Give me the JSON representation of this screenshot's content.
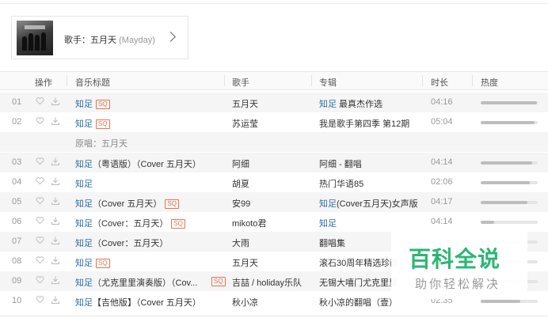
{
  "artist": {
    "prefix": "歌手：",
    "name": "五月天",
    "english": "(Mayday)"
  },
  "columns": {
    "action": "操作",
    "title": "音乐标题",
    "singer": "歌手",
    "album": "专辑",
    "duration": "时长",
    "heat": "热度"
  },
  "quality_badge": "SQ",
  "rows": [
    {
      "idx": "01",
      "title": "知足",
      "title_tail": "",
      "sq": true,
      "sq_right": false,
      "singer": "五月天",
      "album_link": "知足",
      "album_text": " 最真杰作选",
      "dur": "04:16",
      "heat": 0.98
    },
    {
      "idx": "02",
      "title": "知足",
      "title_tail": "",
      "sq": true,
      "sq_right": false,
      "singer": "苏运莹",
      "album_link": "",
      "album_text": "我是歌手第四季 第12期",
      "dur": "05:04",
      "heat": 0.94
    },
    {
      "idx": "03",
      "title": "知足",
      "title_tail": "（粤语版）（Cover 五月天）",
      "sq": false,
      "sq_right": false,
      "singer": "阿细",
      "album_link": "",
      "album_text": "阿细 - 翻唱",
      "dur": "04:14",
      "heat": 0.9
    },
    {
      "idx": "04",
      "title": "知足",
      "title_tail": "",
      "sq": false,
      "sq_right": false,
      "singer": "胡夏",
      "album_link": "",
      "album_text": "热门华语85",
      "dur": "02:06",
      "heat": 0.86
    },
    {
      "idx": "05",
      "title": "知足",
      "title_tail": "（Cover 五月天）",
      "sq": true,
      "sq_right": false,
      "singer": "安99",
      "album_link": "知足",
      "album_text": "(Cover五月天)女声版",
      "dur": "04:17",
      "heat": 0.82
    },
    {
      "idx": "06",
      "title": "知足",
      "title_tail": "（Cover：五月天）",
      "sq": true,
      "sq_right": false,
      "singer": "mikoto君",
      "album_link": "知足",
      "album_text": "",
      "dur": "04:14",
      "heat": 0.24
    },
    {
      "idx": "07",
      "title": "知足",
      "title_tail": "（Cover：五月天）",
      "sq": false,
      "sq_right": false,
      "singer": "大雨",
      "album_link": "",
      "album_text": "翻唱集",
      "dur": "",
      "heat": 0.6
    },
    {
      "idx": "08",
      "title": "知足",
      "title_tail": "",
      "sq": true,
      "sq_right": false,
      "singer": "五月天",
      "album_link": "",
      "album_text": "滚石30周年精选珍藏",
      "dur": "",
      "heat": 0.6
    },
    {
      "idx": "09",
      "title": "知足",
      "title_tail": "（尤克里里演奏版）（Cov...",
      "sq": false,
      "sq_right": true,
      "singer": "吉喆 / holiday乐队",
      "album_link": "",
      "album_text": "无锡大嘻门尤克里里",
      "dur": "",
      "heat": 0.6
    },
    {
      "idx": "10",
      "title": "知足",
      "title_tail": "【吉他版】（Cover 五月天）",
      "sq": false,
      "sq_right": false,
      "singer": "秋小凉",
      "album_link": "",
      "album_text": "秋小凉的翻唱（壹）",
      "dur": "02:35",
      "heat": 0.7
    }
  ],
  "original_singer_note": "原唱：五月天",
  "watermark": {
    "title": "百科全说",
    "subtitle": "助你轻松解决",
    "color": "#2bb673"
  }
}
